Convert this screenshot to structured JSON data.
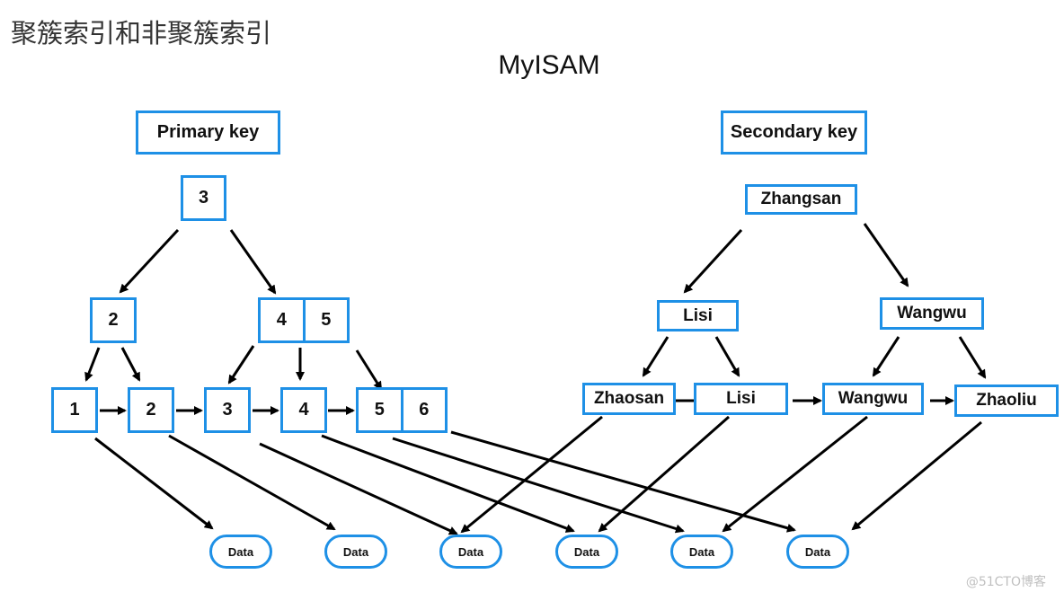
{
  "header": {
    "title_cn": "聚簇索引和非聚簇索引",
    "title_main": "MyISAM"
  },
  "primary": {
    "label": "Primary key",
    "root": "3",
    "internal_left": "2",
    "internal_right": [
      "4",
      "5"
    ],
    "leaves": [
      "1",
      "2",
      "3",
      "4",
      "5",
      "6"
    ]
  },
  "secondary": {
    "label": "Secondary key",
    "root": "Zhangsan",
    "internal_left": "Lisi",
    "internal_right": "Wangwu",
    "leaves": [
      "Zhaosan",
      "Lisi",
      "Wangwu",
      "Zhaoliu"
    ]
  },
  "data_nodes": [
    "Data",
    "Data",
    "Data",
    "Data",
    "Data",
    "Data"
  ],
  "colors": {
    "node_border": "#1e90e6",
    "arrow": "#000000"
  },
  "watermark": "@51CTO博客"
}
